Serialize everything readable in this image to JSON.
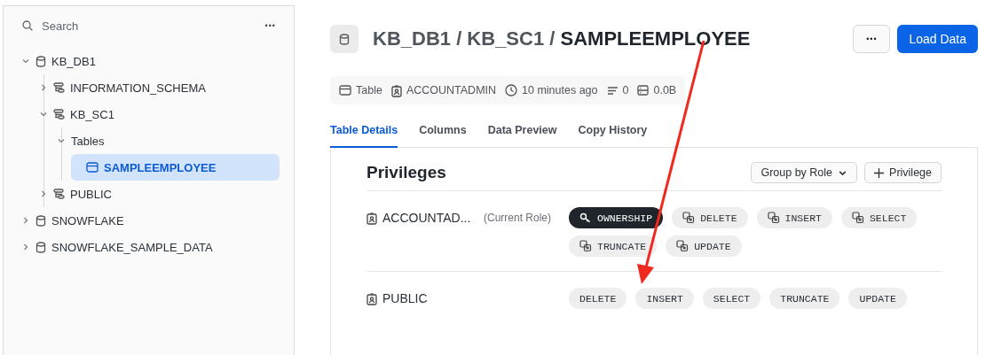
{
  "sidebar": {
    "search": {
      "placeholder": "Search"
    },
    "more": "•••",
    "tree": [
      {
        "kind": "database",
        "label": "KB_DB1",
        "expanded": true,
        "selected": false,
        "children": [
          {
            "kind": "schema",
            "label": "INFORMATION_SCHEMA",
            "expanded": false,
            "selected": false
          },
          {
            "kind": "schema",
            "label": "KB_SC1",
            "expanded": true,
            "selected": false,
            "children": [
              {
                "label": "Tables",
                "expanded": true,
                "selected": false,
                "children": [
                  {
                    "kind": "table",
                    "label": "SAMPLEEMPLOYEE",
                    "selected": true
                  }
                ]
              }
            ]
          },
          {
            "kind": "schema",
            "label": "PUBLIC",
            "expanded": false,
            "selected": false
          }
        ]
      },
      {
        "kind": "database",
        "label": "SNOWFLAKE",
        "expanded": false,
        "selected": false
      },
      {
        "kind": "database",
        "label": "SNOWFLAKE_SAMPLE_DATA",
        "expanded": false,
        "selected": false
      }
    ]
  },
  "header": {
    "path": "KB_DB1 / KB_SC1 / ",
    "name": "SAMPLEEMPLOYEE",
    "more": "•••",
    "primary_button": "Load Data"
  },
  "meta": [
    {
      "kind": "table",
      "text": "Table"
    },
    {
      "kind": "owner",
      "text": "ACCOUNTADMIN"
    },
    {
      "kind": "clock",
      "text": "10 minutes ago"
    },
    {
      "kind": "rows",
      "text": "0"
    },
    {
      "kind": "size",
      "text": "0.0B"
    }
  ],
  "tabs": [
    {
      "label": "Table Details",
      "selected": true
    },
    {
      "label": "Columns",
      "selected": false
    },
    {
      "label": "Data Preview",
      "selected": false
    },
    {
      "label": "Copy History",
      "selected": false
    }
  ],
  "privileges": {
    "title": "Privileges",
    "group_button": "Group by Role",
    "add_button": "Privilege",
    "roles": [
      {
        "name": "ACCOUNTAD...",
        "note": "(Current Role)",
        "chips": [
          {
            "kind": "owner",
            "label": "OWNERSHIP"
          },
          {
            "kind": "grant",
            "label": "DELETE"
          },
          {
            "kind": "grant",
            "label": "INSERT"
          },
          {
            "kind": "grant",
            "label": "SELECT"
          },
          {
            "kind": "grant",
            "label": "TRUNCATE"
          },
          {
            "kind": "grant",
            "label": "UPDATE"
          }
        ]
      },
      {
        "name": "PUBLIC",
        "chips": [
          {
            "kind": "plain",
            "label": "DELETE"
          },
          {
            "kind": "plain",
            "label": "INSERT"
          },
          {
            "kind": "plain",
            "label": "SELECT"
          },
          {
            "kind": "plain",
            "label": "TRUNCATE"
          },
          {
            "kind": "plain",
            "label": "UPDATE"
          }
        ]
      }
    ]
  }
}
